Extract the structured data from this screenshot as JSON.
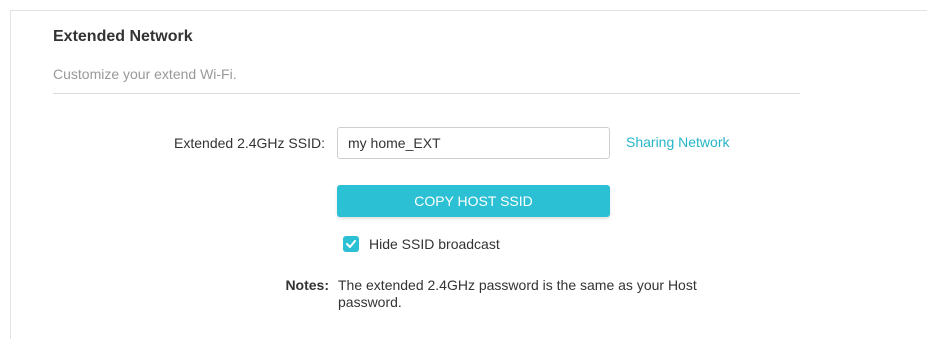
{
  "section": {
    "title": "Extended Network",
    "description": "Customize your extend Wi-Fi."
  },
  "ssid": {
    "label": "Extended 2.4GHz SSID:",
    "value": "my home_EXT",
    "sharing_link": "Sharing Network"
  },
  "copy_button": "COPY HOST SSID",
  "hide_ssid": {
    "label": "Hide SSID broadcast",
    "checked": true,
    "icon": "checkmark-icon"
  },
  "notes": {
    "label": "Notes:",
    "text": "The extended 2.4GHz password is the same as your Host password."
  },
  "colors": {
    "accent": "#2bc0d3",
    "link": "#26b5c7",
    "text": "#333333",
    "muted": "#999999"
  }
}
